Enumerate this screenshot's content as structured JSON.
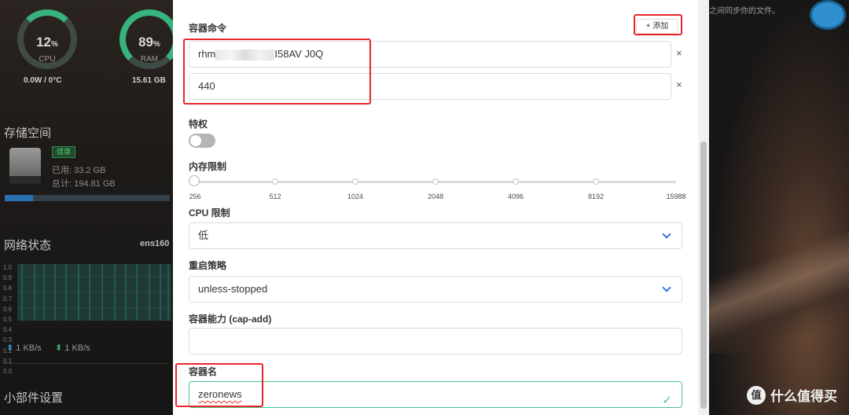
{
  "background": {
    "gauges": [
      {
        "value": "12",
        "unit": "%",
        "label": "CPU",
        "sub": "0.0W / 0°C"
      },
      {
        "value": "89",
        "unit": "%",
        "label": "RAM",
        "sub": "15.61 GB"
      }
    ],
    "storage": {
      "title": "存储空间",
      "badge": "健康",
      "used": "已用: 33.2 GB",
      "total": "总计: 194.81 GB",
      "fill_fraction": 0.17
    },
    "network": {
      "title": "网络状态",
      "interface": "ens160",
      "ticks": [
        "1.0",
        "0.9",
        "0.8",
        "0.7",
        "0.6",
        "0.5",
        "0.4",
        "0.3",
        "0.2",
        "0.1",
        "0.0"
      ],
      "upload": "1 KB/s",
      "download": "1 KB/s"
    },
    "widgets_title": "小部件设置",
    "right_hint": "之间同步你的文件。",
    "watermark": "什么值得买",
    "watermark_icon": "值"
  },
  "form": {
    "command": {
      "label": "容器命令",
      "add_label": "+ 添加",
      "rows": [
        {
          "value_prefix": "rhm",
          "value_suffix": "I58AV   J0Q"
        },
        {
          "value": "440"
        }
      ],
      "remove_glyph": "×"
    },
    "privileged": {
      "label": "特权",
      "checked": false
    },
    "memory": {
      "label": "内存限制",
      "ticks": [
        "256",
        "512",
        "1024",
        "2048",
        "4096",
        "8192",
        "15988"
      ],
      "selected": "256"
    },
    "cpu": {
      "label": "CPU 限制",
      "selected": "低"
    },
    "restart": {
      "label": "重启策略",
      "selected": "unless-stopped"
    },
    "capadd": {
      "label": "容器能力 (cap-add)",
      "value": ""
    },
    "name": {
      "label": "容器名",
      "value": "zeronews"
    }
  },
  "colors": {
    "accent": "#3273dc",
    "success": "#48c78e",
    "annotation": "#e8262a"
  }
}
